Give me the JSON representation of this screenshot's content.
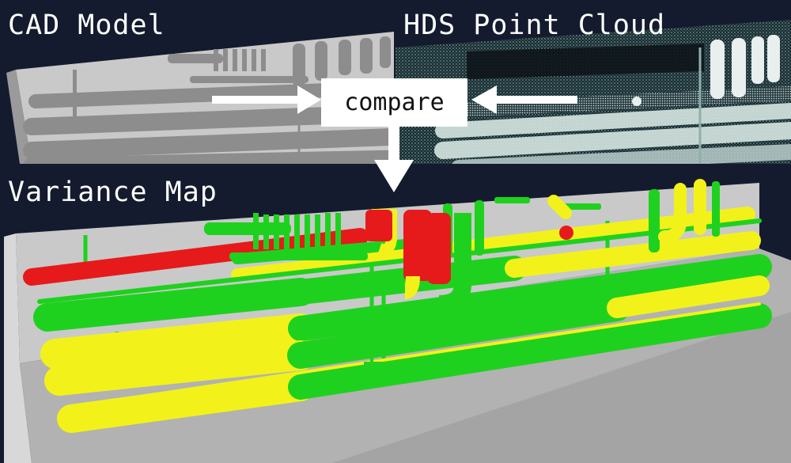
{
  "panels": {
    "cad": {
      "title": "CAD Model"
    },
    "hds": {
      "title": "HDS Point Cloud"
    },
    "variance": {
      "title": "Variance Map"
    }
  },
  "compare": {
    "label": "compare"
  },
  "colors": {
    "background": "#141b2e",
    "wall": "#c9c9c9",
    "floor": "#a7a7a7",
    "cad_pipe": "#8d8d8d",
    "cloud_pipe": "#dfe9e8",
    "ok": "#1fd11f",
    "warning": "#f2f21a",
    "out_of_tolerance": "#e61a1a"
  }
}
